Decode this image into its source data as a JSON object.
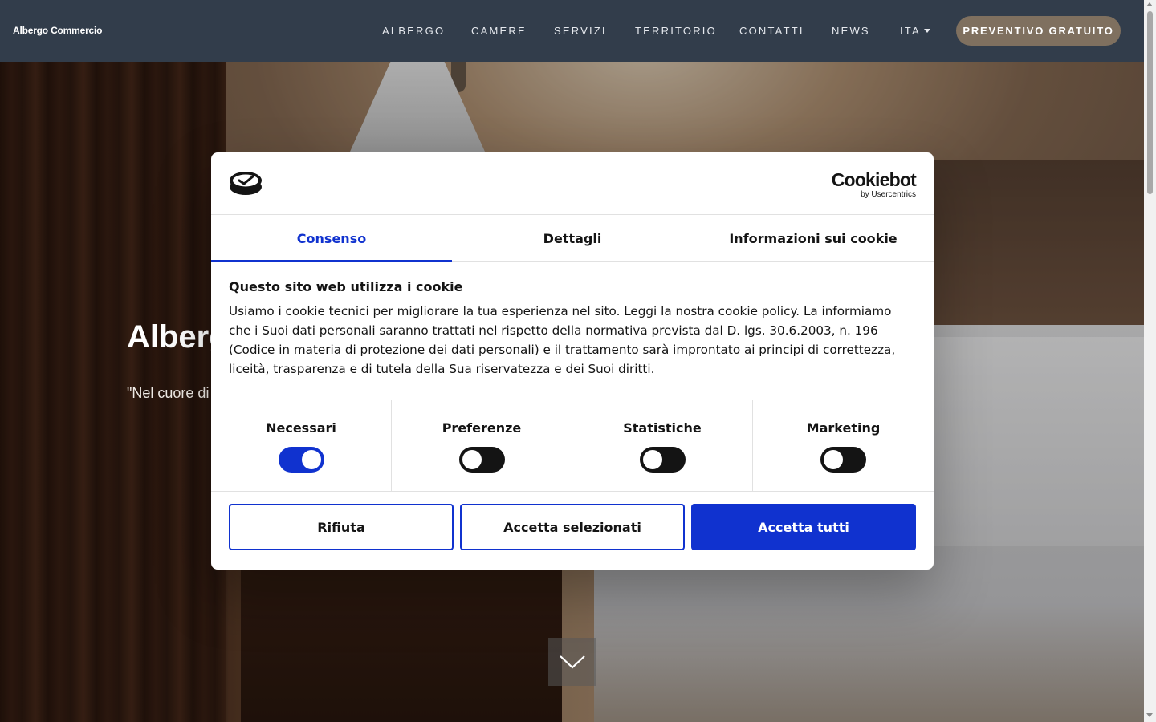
{
  "navbar": {
    "brand": "Albergo Commercio",
    "items": [
      {
        "label": "ALBERGO"
      },
      {
        "label": "CAMERE"
      },
      {
        "label": "SERVIZI"
      },
      {
        "label": "TERRITORIO"
      },
      {
        "label": "CONTATTI"
      },
      {
        "label": "NEWS"
      },
      {
        "label": "ITA"
      }
    ],
    "cta": "PREVENTIVO GRATUITO"
  },
  "hero": {
    "title": "Albergo Commercio",
    "quote": "\"Nel cuore di"
  },
  "cookie_dialog": {
    "brand_word": "Cookiebot",
    "brand_sub": "by Usercentrics",
    "tabs": [
      {
        "label": "Consenso",
        "active": true
      },
      {
        "label": "Dettagli",
        "active": false
      },
      {
        "label": "Informazioni sui cookie",
        "active": false
      }
    ],
    "heading": "Questo sito web utilizza i cookie",
    "body": "Usiamo i cookie tecnici per migliorare la tua esperienza nel sito. Leggi la nostra cookie policy. La informiamo che i Suoi dati personali saranno trattati nel rispetto della normativa prevista dal D. lgs. 30.6.2003, n. 196 (Codice in materia di protezione dei dati personali) e il trattamento sarà improntato ai principi di correttezza, liceità, trasparenza e di tutela della Sua riservatezza e dei Suoi diritti.",
    "categories": [
      {
        "label": "Necessari",
        "enabled": true
      },
      {
        "label": "Preferenze",
        "enabled": false
      },
      {
        "label": "Statistiche",
        "enabled": false
      },
      {
        "label": "Marketing",
        "enabled": false
      }
    ],
    "buttons": {
      "reject": "Rifiuta",
      "accept_selected": "Accetta selezionati",
      "accept_all": "Accetta tutti"
    }
  },
  "colors": {
    "navbar_bg": "#323d4b",
    "cta_bg": "#7f705f",
    "accent_blue": "#1032cf"
  },
  "icons": {
    "scroll_down": "chevron-down-icon",
    "dialog_logo": "cookie-logo-icon",
    "language_caret": "caret-down-icon"
  }
}
